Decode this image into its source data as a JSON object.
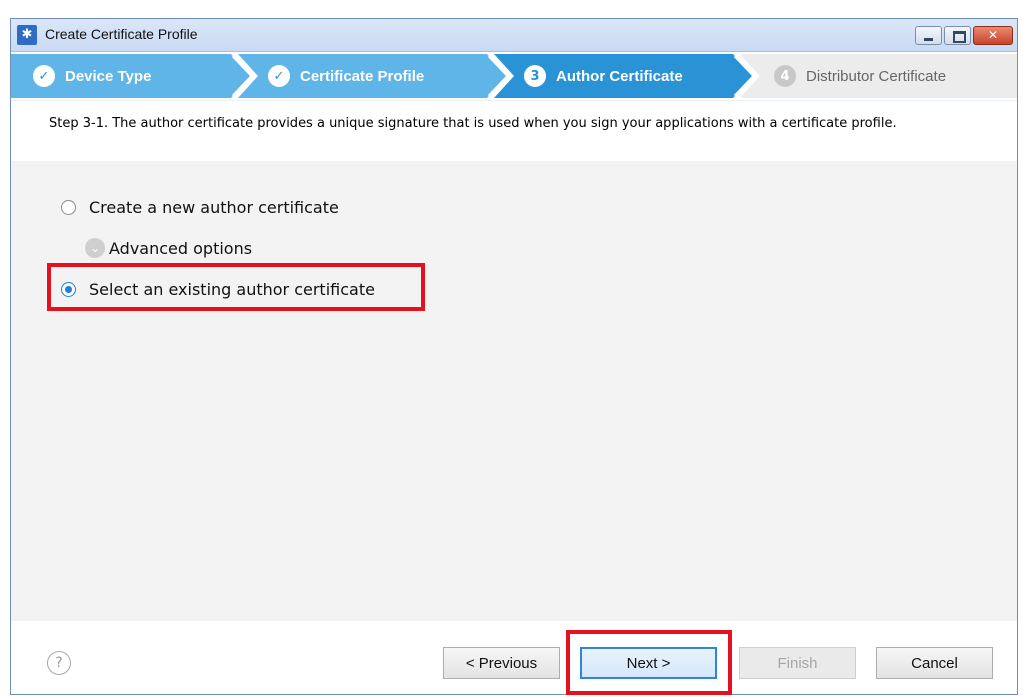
{
  "window": {
    "title": "Create Certificate Profile",
    "icon": "tizen-app-icon"
  },
  "steps": [
    {
      "number": "✓",
      "label": "Device Type",
      "state": "done"
    },
    {
      "number": "✓",
      "label": "Certificate Profile",
      "state": "done"
    },
    {
      "number": "3",
      "label": "Author Certificate",
      "state": "active"
    },
    {
      "number": "4",
      "label": "Distributor Certificate",
      "state": "future"
    }
  ],
  "description": "Step 3-1. The author certificate provides a unique signature that is used when you sign your applications with a certificate profile.",
  "options": {
    "create_new": {
      "label": "Create a new author certificate",
      "checked": false
    },
    "advanced": {
      "label": "Advanced options"
    },
    "select_existing": {
      "label": "Select an existing author certificate",
      "checked": true
    }
  },
  "buttons": {
    "help": "?",
    "previous": "< Previous",
    "next": "Next >",
    "finish": "Finish",
    "cancel": "Cancel"
  },
  "colors": {
    "step_done": "#5fb4e8",
    "step_active": "#2a93d5",
    "step_future": "#ececec",
    "highlight": "#e4121f",
    "content_bg": "#f3f3f3"
  }
}
